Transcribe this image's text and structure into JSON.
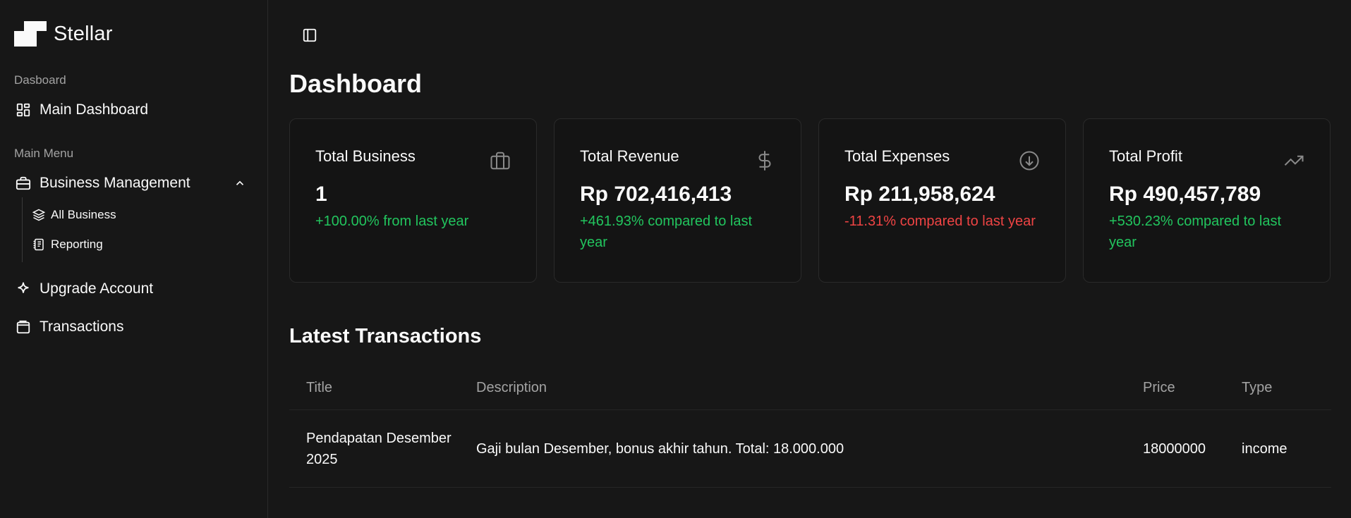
{
  "brand": {
    "name": "Stellar"
  },
  "sidebar": {
    "group1_label": "Dasboard",
    "main_dashboard": "Main Dashboard",
    "group2_label": "Main Menu",
    "business_management": "Business Management",
    "sub_items": [
      {
        "label": "All Business",
        "icon": "layers-icon"
      },
      {
        "label": "Reporting",
        "icon": "notebook-icon"
      }
    ],
    "upgrade_account": "Upgrade Account",
    "transactions": "Transactions"
  },
  "header": {
    "title": "Dashboard"
  },
  "cards": [
    {
      "title": "Total Business",
      "value": "1",
      "change": "+100.00% from last year",
      "trend": "positive",
      "icon": "briefcase-icon"
    },
    {
      "title": "Total Revenue",
      "value": "Rp 702,416,413",
      "change": "+461.93% compared to last year",
      "trend": "positive",
      "icon": "dollar-icon"
    },
    {
      "title": "Total Expenses",
      "value": "Rp 211,958,624",
      "change": "-11.31% compared to last year",
      "trend": "negative",
      "icon": "arrow-down-circle-icon"
    },
    {
      "title": "Total Profit",
      "value": "Rp 490,457,789",
      "change": "+530.23% compared to last year",
      "trend": "positive",
      "icon": "trending-up-icon"
    }
  ],
  "transactions": {
    "title": "Latest Transactions",
    "columns": {
      "title": "Title",
      "description": "Description",
      "price": "Price",
      "type": "Type"
    },
    "rows": [
      {
        "title": "Pendapatan Desember 2025",
        "description": "Gaji bulan Desember, bonus akhir tahun. Total: 18.000.000",
        "price": "18000000",
        "type": "income"
      }
    ]
  },
  "colors": {
    "positive": "#22c55e",
    "negative": "#ef4444",
    "background": "#171717"
  }
}
